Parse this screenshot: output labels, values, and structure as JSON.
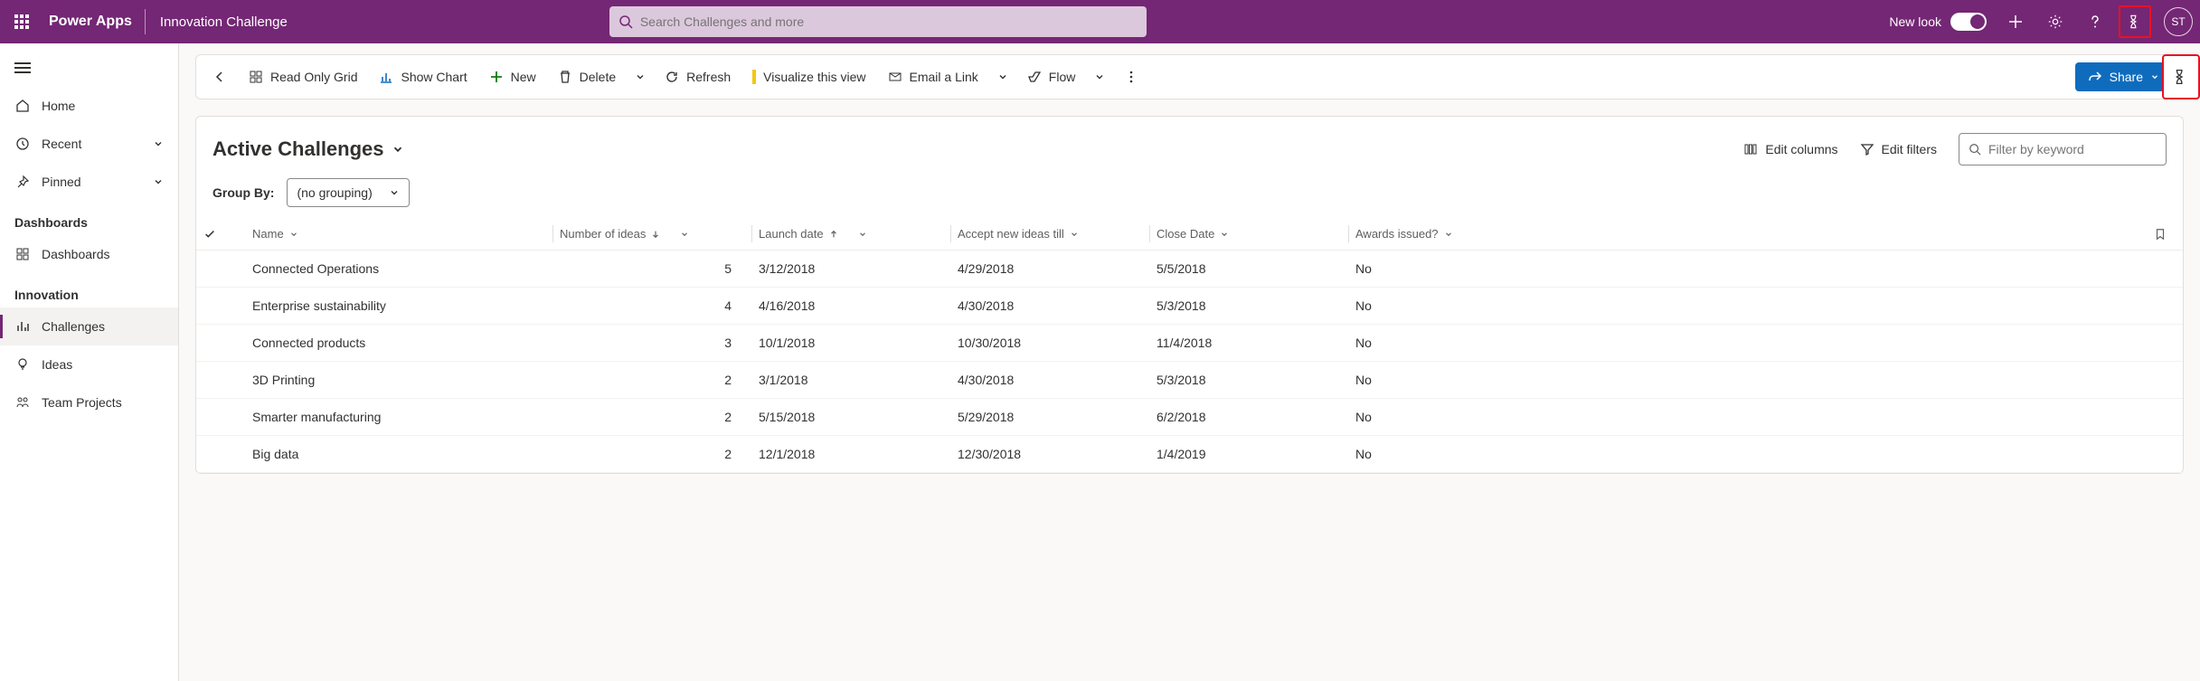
{
  "header": {
    "brand": "Power Apps",
    "app_title": "Innovation Challenge",
    "search_placeholder": "Search Challenges and more",
    "new_look_label": "New look",
    "avatar_initials": "ST"
  },
  "sidebar": {
    "items": [
      {
        "label": "Home"
      },
      {
        "label": "Recent"
      },
      {
        "label": "Pinned"
      }
    ],
    "sections": [
      {
        "title": "Dashboards",
        "items": [
          {
            "label": "Dashboards"
          }
        ]
      },
      {
        "title": "Innovation",
        "items": [
          {
            "label": "Challenges",
            "active": true
          },
          {
            "label": "Ideas"
          },
          {
            "label": "Team Projects"
          }
        ]
      }
    ]
  },
  "commandbar": {
    "readonly_grid": "Read Only Grid",
    "show_chart": "Show Chart",
    "new": "New",
    "delete": "Delete",
    "refresh": "Refresh",
    "visualize": "Visualize this view",
    "email": "Email a Link",
    "flow": "Flow",
    "share": "Share"
  },
  "view": {
    "title": "Active Challenges",
    "edit_columns": "Edit columns",
    "edit_filters": "Edit filters",
    "filter_placeholder": "Filter by keyword",
    "group_by_label": "Group By:",
    "group_by_value": "(no grouping)"
  },
  "table": {
    "columns": {
      "name": "Name",
      "ideas": "Number of ideas",
      "launch": "Launch date",
      "accept": "Accept new ideas till",
      "close": "Close Date",
      "awards": "Awards issued?"
    },
    "rows": [
      {
        "name": "Connected Operations",
        "ideas": "5",
        "launch": "3/12/2018",
        "accept": "4/29/2018",
        "close": "5/5/2018",
        "awards": "No"
      },
      {
        "name": "Enterprise sustainability",
        "ideas": "4",
        "launch": "4/16/2018",
        "accept": "4/30/2018",
        "close": "5/3/2018",
        "awards": "No"
      },
      {
        "name": "Connected products",
        "ideas": "3",
        "launch": "10/1/2018",
        "accept": "10/30/2018",
        "close": "11/4/2018",
        "awards": "No"
      },
      {
        "name": "3D Printing",
        "ideas": "2",
        "launch": "3/1/2018",
        "accept": "4/30/2018",
        "close": "5/3/2018",
        "awards": "No"
      },
      {
        "name": "Smarter manufacturing",
        "ideas": "2",
        "launch": "5/15/2018",
        "accept": "5/29/2018",
        "close": "6/2/2018",
        "awards": "No"
      },
      {
        "name": "Big data",
        "ideas": "2",
        "launch": "12/1/2018",
        "accept": "12/30/2018",
        "close": "1/4/2019",
        "awards": "No"
      }
    ]
  }
}
